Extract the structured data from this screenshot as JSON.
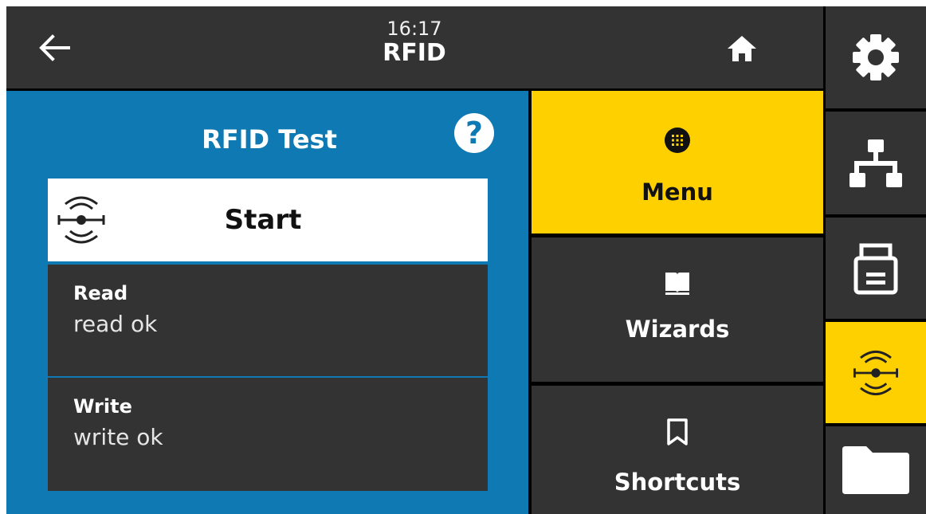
{
  "header": {
    "time": "16:17",
    "title": "RFID",
    "back_icon": "arrow-left-icon",
    "home_icon": "home-icon"
  },
  "panel": {
    "title": "RFID Test",
    "help_label": "?",
    "start_label": "Start",
    "start_icon": "rfid-icon",
    "results": [
      {
        "label": "Read",
        "value": "read ok"
      },
      {
        "label": "Write",
        "value": "write ok"
      }
    ]
  },
  "menu": {
    "items": [
      {
        "label": "Menu",
        "icon": "grid-menu-icon",
        "active": true
      },
      {
        "label": "Wizards",
        "icon": "book-icon",
        "active": false
      },
      {
        "label": "Shortcuts",
        "icon": "bookmark-icon",
        "active": false
      }
    ]
  },
  "side_nav": {
    "items": [
      {
        "icon": "gear-icon",
        "active": false
      },
      {
        "icon": "network-icon",
        "active": false
      },
      {
        "icon": "printer-icon",
        "active": false
      },
      {
        "icon": "rfid-icon",
        "active": true
      },
      {
        "icon": "folder-icon",
        "active": false
      }
    ]
  },
  "colors": {
    "panel_blue": "#0e79b2",
    "accent_yellow": "#ffd000",
    "dark_gray": "#333333"
  }
}
